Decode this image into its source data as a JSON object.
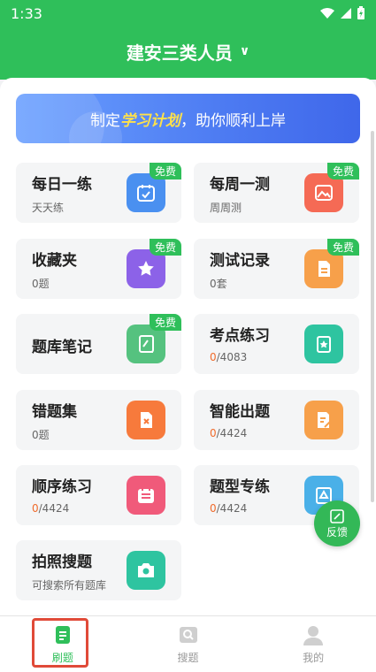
{
  "status": {
    "time": "1:33"
  },
  "header": {
    "title": "建安三类人员",
    "chevron": "∨"
  },
  "banner": {
    "prefix": "制定",
    "highlight": "学习计划",
    "suffix": "，助你顺利上岸"
  },
  "cards": [
    {
      "title": "每日一练",
      "sub": "天天练",
      "badge": "免费",
      "icon": "calendar-check-icon",
      "color": "#4a90f0"
    },
    {
      "title": "每周一测",
      "sub": "周周测",
      "badge": "免费",
      "icon": "image-icon",
      "color": "#f56a55"
    },
    {
      "title": "收藏夹",
      "sub": "0题",
      "badge": "免费",
      "icon": "star-icon",
      "color": "#8c62e8"
    },
    {
      "title": "测试记录",
      "sub": "0套",
      "badge": "免费",
      "icon": "document-icon",
      "color": "#f7a04a"
    },
    {
      "title": "题库笔记",
      "badge": "免费",
      "icon": "notebook-icon",
      "color": "#55c27f"
    },
    {
      "title": "考点练习",
      "sub_current": "0",
      "sub_total": "/4083",
      "icon": "clipboard-star-icon",
      "color": "#2ec4a0"
    },
    {
      "title": "错题集",
      "sub": "0题",
      "icon": "error-file-icon",
      "color": "#f77a3c"
    },
    {
      "title": "智能出题",
      "sub_current": "0",
      "sub_total": "/4424",
      "icon": "edit-doc-icon",
      "color": "#f7a04a"
    },
    {
      "title": "顺序练习",
      "sub_current": "0",
      "sub_total": "/4424",
      "icon": "list-calendar-icon",
      "color": "#f05a7a"
    },
    {
      "title": "题型专练",
      "sub_current": "0",
      "sub_total": "/4424",
      "icon": "triangle-clipboard-icon",
      "color": "#4ab0e8"
    },
    {
      "title": "拍照搜题",
      "sub": "可搜索所有题库",
      "icon": "camera-icon",
      "color": "#2ec4a0"
    }
  ],
  "feedback": {
    "label": "反馈"
  },
  "tabs": [
    {
      "label": "刷题",
      "icon": "practice-icon"
    },
    {
      "label": "搜题",
      "icon": "search-icon"
    },
    {
      "label": "我的",
      "icon": "profile-icon"
    }
  ]
}
